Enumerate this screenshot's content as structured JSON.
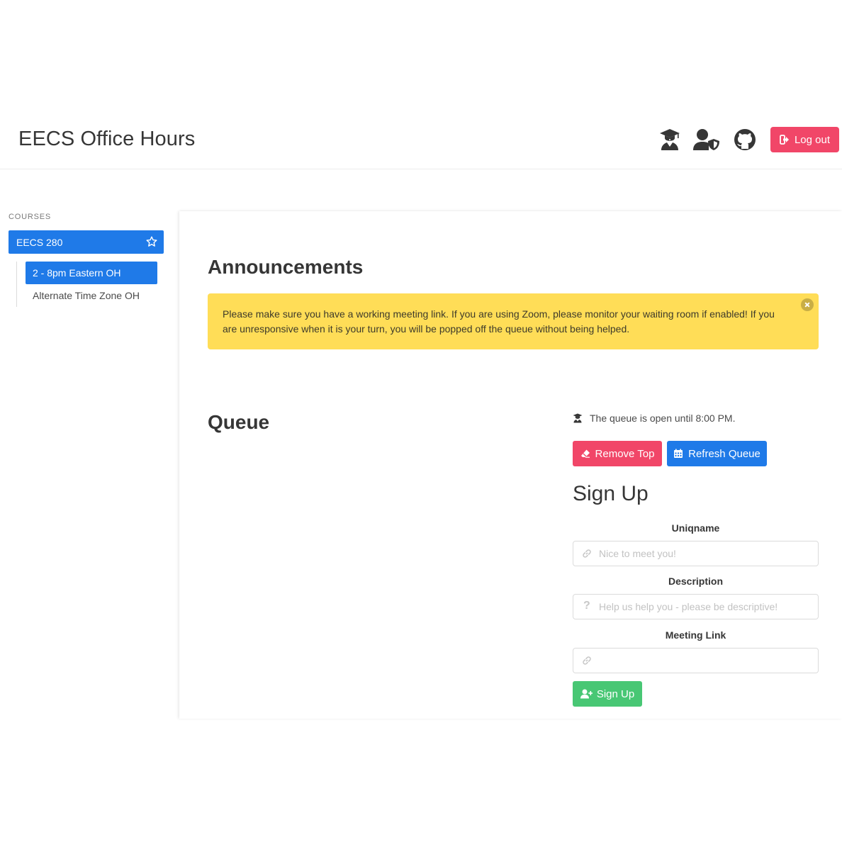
{
  "navbar": {
    "brand": "EECS Office Hours",
    "logout_label": "Log out",
    "icons": [
      "student-icon",
      "admin-user-shield-icon",
      "github-icon",
      "logout-icon"
    ]
  },
  "sidebar": {
    "label": "COURSES",
    "course": "EECS 280",
    "queues": [
      {
        "label": "2 - 8pm Eastern OH",
        "active": true
      },
      {
        "label": "Alternate Time Zone OH",
        "active": false
      }
    ]
  },
  "announcements": {
    "title": "Announcements",
    "message": "Please make sure you have a working meeting link. If you are using Zoom, please monitor your waiting room if enabled! If you are unresponsive when it is your turn, you will be popped off the queue without being helped."
  },
  "queue": {
    "title": "Queue",
    "status": "The queue is open until 8:00 PM.",
    "remove_label": "Remove Top",
    "refresh_label": "Refresh Queue"
  },
  "signup": {
    "title": "Sign Up",
    "uniqname_label": "Uniqname",
    "uniqname_placeholder": "Nice to meet you!",
    "description_label": "Description",
    "description_placeholder": "Help us help you - please be descriptive!",
    "meeting_label": "Meeting Link",
    "meeting_placeholder": "",
    "submit_label": "Sign Up"
  },
  "colors": {
    "primary": "#1f7ae8",
    "danger": "#f14668",
    "success": "#48c774",
    "warning": "#ffdd57"
  }
}
